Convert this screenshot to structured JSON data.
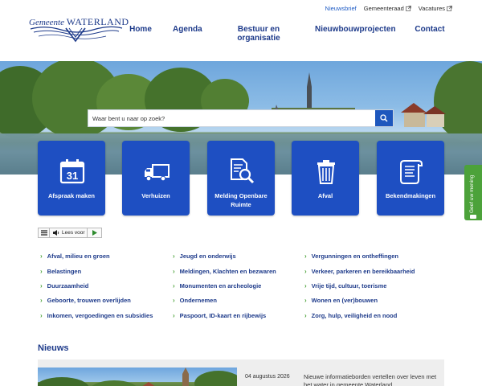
{
  "header": {
    "logo": {
      "word1": "Gemeente",
      "word2": "WATERLAND"
    },
    "topnav": [
      {
        "label": "Nieuwsbrief",
        "external": false
      },
      {
        "label": "Gemeenteraad",
        "external": true
      },
      {
        "label": "Vacatures",
        "external": true
      }
    ],
    "mainnav": [
      {
        "line1": "Home",
        "line2": ""
      },
      {
        "line1": "Agenda",
        "line2": ""
      },
      {
        "line1": "Bestuur en",
        "line2": "organisatie"
      },
      {
        "line1": "Nieuwbouwprojecten",
        "line2": ""
      },
      {
        "line1": "Contact",
        "line2": ""
      }
    ]
  },
  "search": {
    "placeholder": "Waar bent u naar op zoek?"
  },
  "tiles": [
    {
      "line1": "Afspraak maken",
      "line2": "",
      "icon": "calendar-icon",
      "day": "31"
    },
    {
      "line1": "Verhuizen",
      "line2": "",
      "icon": "truck-icon"
    },
    {
      "line1": "Melding Openbare",
      "line2": "Ruimte",
      "icon": "report-search-icon"
    },
    {
      "line1": "Afval",
      "line2": "",
      "icon": "trash-bin-icon"
    },
    {
      "line1": "Bekendmakingen",
      "line2": "",
      "icon": "scroll-icon"
    }
  ],
  "feedback": {
    "label": "Geef uw mening"
  },
  "readspeaker": {
    "label": "Lees voor"
  },
  "links": {
    "col1": [
      "Afval, milieu en groen",
      "Belastingen",
      "Duurzaamheid",
      "Geboorte, trouwen overlijden",
      "Inkomen, vergoedingen en subsidies"
    ],
    "col2": [
      "Jeugd en onderwijs",
      "Meldingen, Klachten en bezwaren",
      "Monumenten en archeologie",
      "Ondernemen",
      "Paspoort, ID-kaart en rijbewijs"
    ],
    "col3": [
      "Vergunningen en ontheffingen",
      "Verkeer, parkeren en bereikbaarheid",
      "Vrije tijd, cultuur, toerisme",
      "Wonen en (ver)bouwen",
      "Zorg, hulp, veiligheid en nood"
    ]
  },
  "news": {
    "title": "Nieuws",
    "items": [
      {
        "date": "04 augustus 2026",
        "headline": "Nieuwe informatieborden vertellen over leven met het water in gemeente Waterland"
      }
    ]
  },
  "colors": {
    "primary": "#1e4fc2",
    "text": "#1d3a8a",
    "accent": "#4ca23a",
    "link": "#1f5cc5"
  }
}
